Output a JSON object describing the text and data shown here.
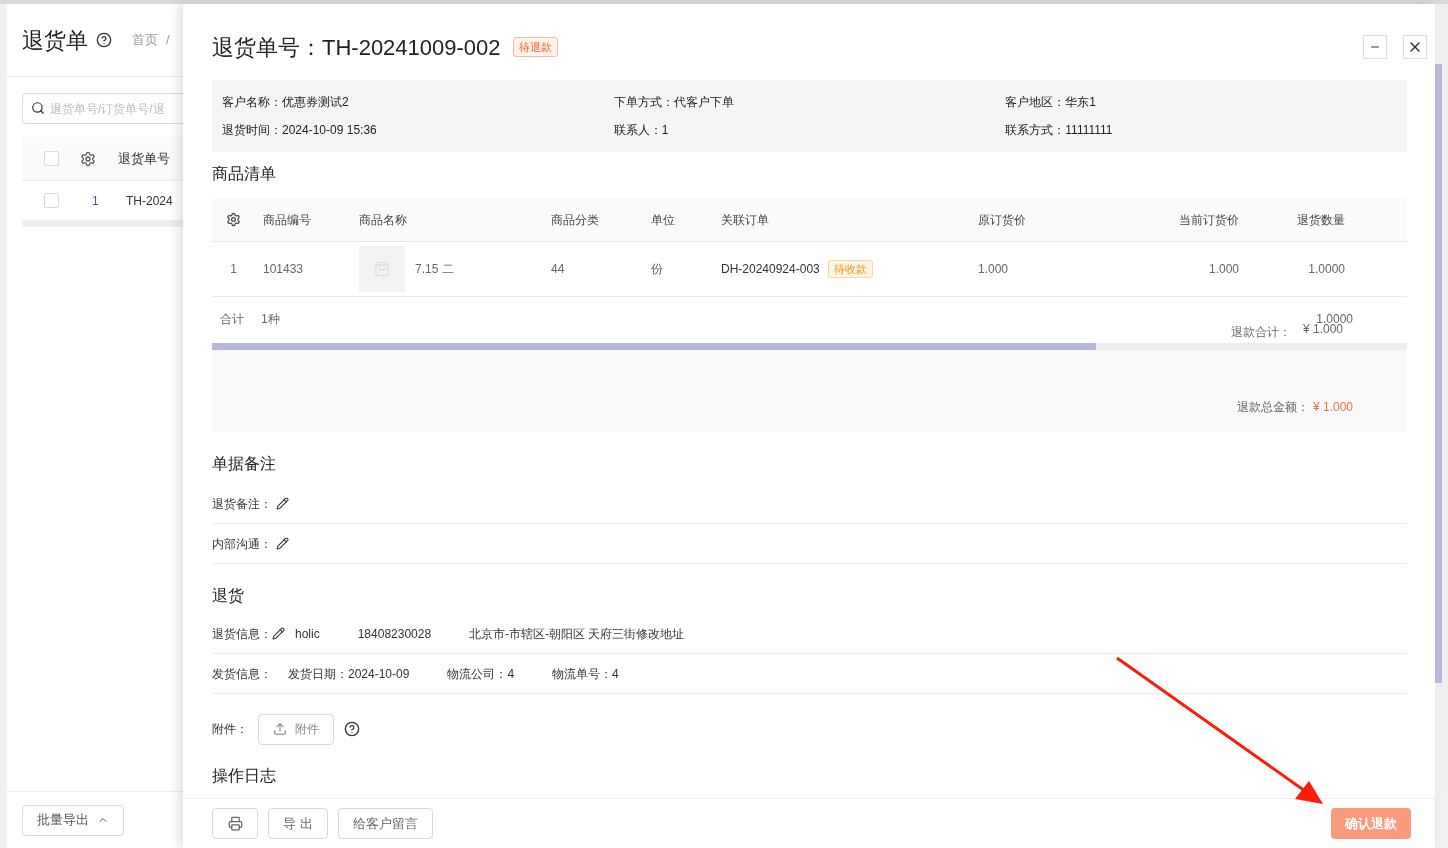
{
  "background_page": {
    "title": "退货单",
    "breadcrumb": "首页",
    "breadcrumb_separator": "/",
    "search": {
      "placeholder": "退货单号/订货单号/退"
    },
    "table": {
      "header_checked": false,
      "columns": [
        "退货单号"
      ],
      "rows": [
        {
          "index": "1",
          "number": "TH-2024",
          "checked": false
        }
      ]
    },
    "export_button": "批量导出"
  },
  "drawer": {
    "title": "退货单号：TH-20241009-002",
    "status": "待退款",
    "info": [
      {
        "label": "客户名称：",
        "value": "优惠券测试2"
      },
      {
        "label": "下单方式：",
        "value": "代客户下单"
      },
      {
        "label": "客户地区：",
        "value": "华东1"
      },
      {
        "label": "退货时间：",
        "value": "2024-10-09 15:36"
      },
      {
        "label": "联系人：",
        "value": "1"
      },
      {
        "label": "联系方式：",
        "value": "11111111"
      }
    ],
    "products": {
      "title": "商品清单",
      "columns": [
        "商品编号",
        "商品名称",
        "商品分类",
        "单位",
        "关联订单",
        "原订货价",
        "当前订货价",
        "退货数量"
      ],
      "rows": [
        {
          "index": "1",
          "code": "101433",
          "name": "7.15 二",
          "category": "44",
          "unit": "份",
          "order": "DH-20240924-003",
          "order_status": "待收款",
          "original_price": "1.000",
          "current_price": "1.000",
          "quantity": "1.0000"
        }
      ],
      "summary_label": "合计",
      "summary_count": "1种",
      "quantity_total": "1.0000",
      "refund_label": "退款合计：",
      "refund_value": "¥ 1.000",
      "total_label": "退款总金额：",
      "total_value": "¥ 1.000"
    },
    "remarks": {
      "title": "单据备注",
      "items": [
        "退货备注：",
        "内部沟通："
      ]
    },
    "return": {
      "title": "退货",
      "return_label": "退货信息：",
      "return_values": [
        "holic",
        "18408230028",
        "北京市-市辖区-朝阳区 天府三街修改地址"
      ],
      "ship_label": "发货信息：",
      "ship_values": [
        "发货日期：2024-10-09",
        "物流公司：4",
        "物流单号：4"
      ],
      "attachment_label": "附件：",
      "attachment_button": "附件"
    },
    "log_title": "操作日志",
    "footer": {
      "export_button": "导 出",
      "message_button": "给客户留言",
      "confirm_button": "确认退款"
    }
  }
}
